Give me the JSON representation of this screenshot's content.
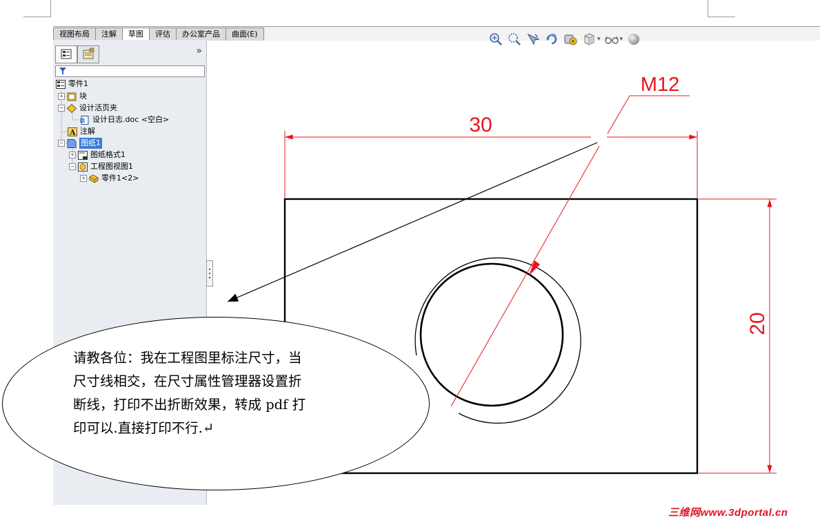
{
  "ribbon": {
    "tabs": [
      {
        "label": "视图布局"
      },
      {
        "label": "注解"
      },
      {
        "label": "草图",
        "active": true
      },
      {
        "label": "评估"
      },
      {
        "label": "办公室产品"
      },
      {
        "label": "曲面(E)"
      }
    ]
  },
  "toolbar": {
    "icons": [
      "zoom-to-fit-icon",
      "zoom-area-icon",
      "pan-icon",
      "rotate-icon",
      "display-style-icon",
      "view-cube-icon",
      "glasses-icon",
      "appearance-sphere-icon"
    ]
  },
  "panel": {
    "collapse_label": "»",
    "tree": [
      {
        "label": "零件1",
        "icon": "drawing-root-icon",
        "level": 0
      },
      {
        "label": "块",
        "icon": "block-icon",
        "level": 1,
        "expander": "+"
      },
      {
        "label": "设计活页夹",
        "icon": "design-binder-icon",
        "level": 1,
        "expander": "−"
      },
      {
        "label": "设计日志.doc <空白>",
        "icon": "document-icon",
        "level": 2
      },
      {
        "label": "注解",
        "icon": "annotation-icon",
        "level": 1
      },
      {
        "label": "图纸1",
        "icon": "sheet-icon",
        "level": 1,
        "expander": "−",
        "selected": true
      },
      {
        "label": "图纸格式1",
        "icon": "sheet-format-icon",
        "level": 2,
        "expander": "+"
      },
      {
        "label": "工程图视图1",
        "icon": "drawing-view-icon",
        "level": 2,
        "expander": "−"
      },
      {
        "label": "零件1<2>",
        "icon": "part-icon",
        "level": 3,
        "expander": "+"
      }
    ]
  },
  "drawing": {
    "dim_width": "30",
    "dim_height": "20",
    "dim_thread": "M12",
    "dim_color": "#e8141c"
  },
  "callout": {
    "lines": [
      "请教各位：我在工程图里标注尺寸，当",
      "尺寸线相交，在尺寸属性管理器设置折",
      "断线，打印不出折断效果，转成 pdf 打",
      "印可以.直接打印不行.↵"
    ]
  },
  "watermark": "三维网www.3dportal.cn"
}
